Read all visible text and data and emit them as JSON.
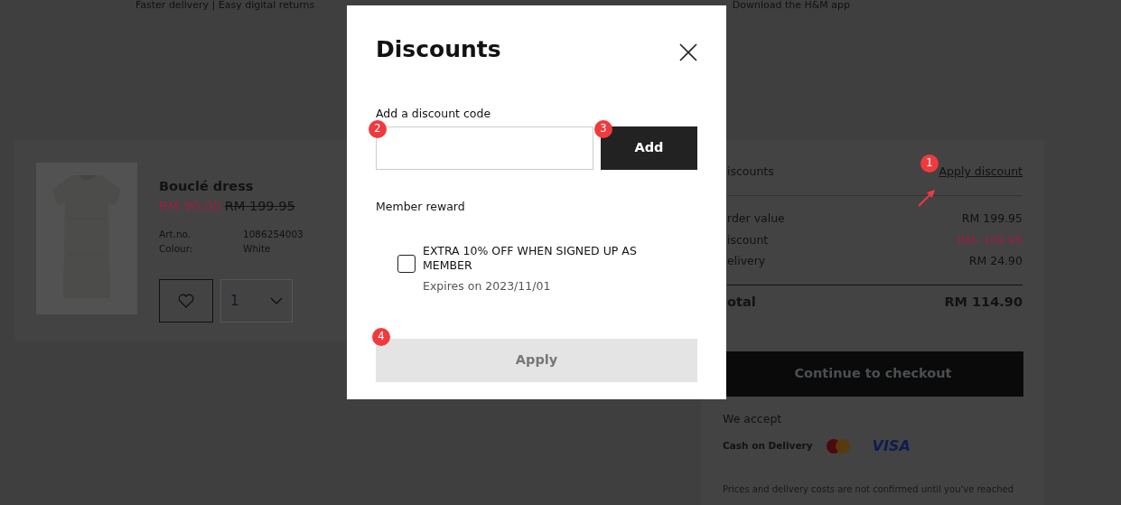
{
  "top_bar": {
    "left": "Faster delivery | Easy digital returns",
    "right": "Download the H&M app"
  },
  "cart_item": {
    "name": "Bouclé dress",
    "sale_price": "RM 90.00",
    "original_price": "RM 199.95",
    "details": [
      {
        "label": "Art.no.",
        "value": "1086254003"
      },
      {
        "label": "Colour:",
        "value": "White"
      }
    ],
    "favourite": false,
    "quantity": "1"
  },
  "summary": {
    "discounts_label": "iscounts",
    "apply_link": "Apply discount",
    "lines": [
      {
        "label": "rder value",
        "value": "RM 199.95",
        "kind": "normal"
      },
      {
        "label": "iscount",
        "value": "RM- 109.95",
        "kind": "discount"
      },
      {
        "label": "elivery",
        "value": "RM 24.90",
        "kind": "normal"
      }
    ],
    "total_label": "otal",
    "total": "RM 114.90",
    "checkout": "Continue to checkout",
    "we_accept": "We accept",
    "payment_label": "Cash on Delivery",
    "card_brand": "VISA",
    "note": "Prices and delivery costs are not confirmed until you've reached"
  },
  "modal": {
    "title": "Discounts",
    "code_label": "Add a discount code",
    "add_button": "Add",
    "reward_label": "Member reward",
    "rewards": [
      {
        "title": "EXTRA 10% OFF WHEN SIGNED UP AS MEMBER",
        "expiry": "Expires on 2023/11/01",
        "checked": false
      }
    ],
    "apply_button": {
      "label": "Apply",
      "disabled": true
    }
  },
  "annotations": [
    {
      "number": "1"
    },
    {
      "number": "2"
    },
    {
      "number": "3"
    },
    {
      "number": "4"
    }
  ]
}
